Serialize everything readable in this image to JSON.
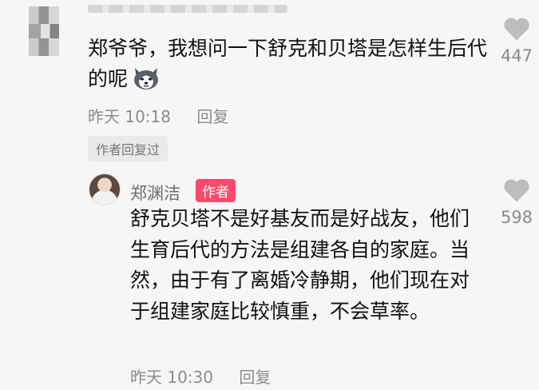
{
  "top_comment": {
    "text": "郑爷爷，我想问一下舒克和贝塔是怎样生后代的呢",
    "time": "昨天 10:18",
    "reply_label": "回复",
    "likes": "447",
    "author_replied_tag": "作者回复过"
  },
  "reply_comment": {
    "author_name": "郑渊洁",
    "author_badge": "作者",
    "text": "舒克贝塔不是好基友而是好战友，他们生育后代的方法是组建各自的家庭。当然，由于有了离婚冷静期，他们现在对于组建家庭比较慎重，不会草率。",
    "time": "昨天 10:30",
    "reply_label": "回复",
    "likes": "598"
  },
  "icons": {
    "like": "heart-icon",
    "emoji": "husky-dog-emoji-icon"
  },
  "colors": {
    "badge": "#fc4a6b",
    "meta_text": "#8b8b8b"
  }
}
